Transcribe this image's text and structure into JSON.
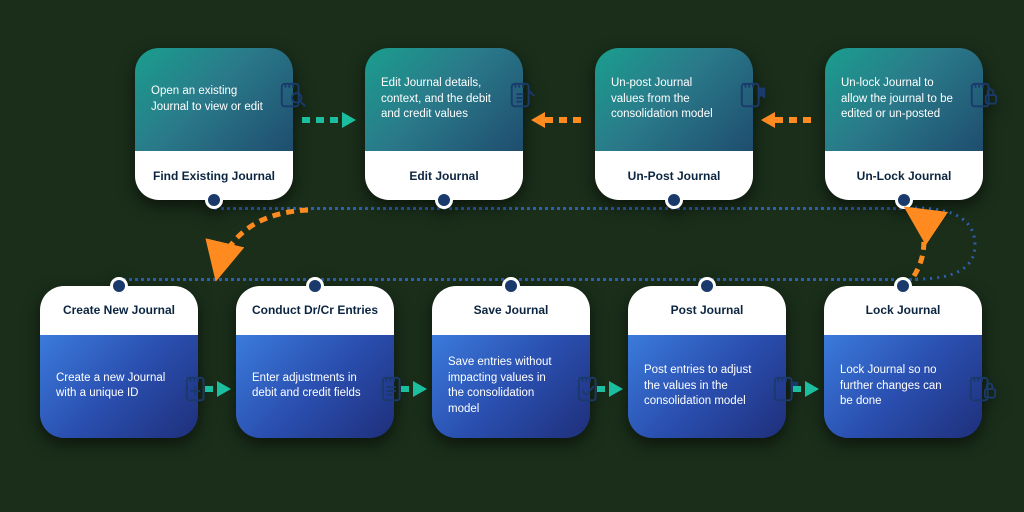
{
  "top_row": [
    {
      "title": "Find Existing Journal",
      "desc": "Open an existing Journal to view or edit",
      "icon": "search"
    },
    {
      "title": "Edit Journal",
      "desc": "Edit Journal details, context, and the debit and credit values",
      "icon": "edit-page"
    },
    {
      "title": "Un-Post Journal",
      "desc": "Un-post Journal values from the consolidation model",
      "icon": "bookmark-page"
    },
    {
      "title": "Un-Lock Journal",
      "desc": "Un-lock Journal to allow the journal to be edited or un-posted",
      "icon": "lock"
    }
  ],
  "bottom_row": [
    {
      "title": "Create New Journal",
      "desc": "Create a new Journal with a unique ID",
      "icon": "plus-page"
    },
    {
      "title": "Conduct Dr/Cr Entries",
      "desc": "Enter adjustments in debit and credit fields",
      "icon": "form-page"
    },
    {
      "title": "Save Journal",
      "desc": "Save entries without impacting values in the consolidation model",
      "icon": "check-page"
    },
    {
      "title": "Post Journal",
      "desc": "Post entries to adjust the values in the consolidation model",
      "icon": "bookmark-page"
    },
    {
      "title": "Lock Journal",
      "desc": "Lock Journal so no further changes can be done",
      "icon": "lock"
    }
  ],
  "colors": {
    "teal": "#1bbfa0",
    "orange": "#ff8a1f",
    "blue_dotted": "#2c5fb0",
    "node_dark": "#1a3a6b"
  }
}
